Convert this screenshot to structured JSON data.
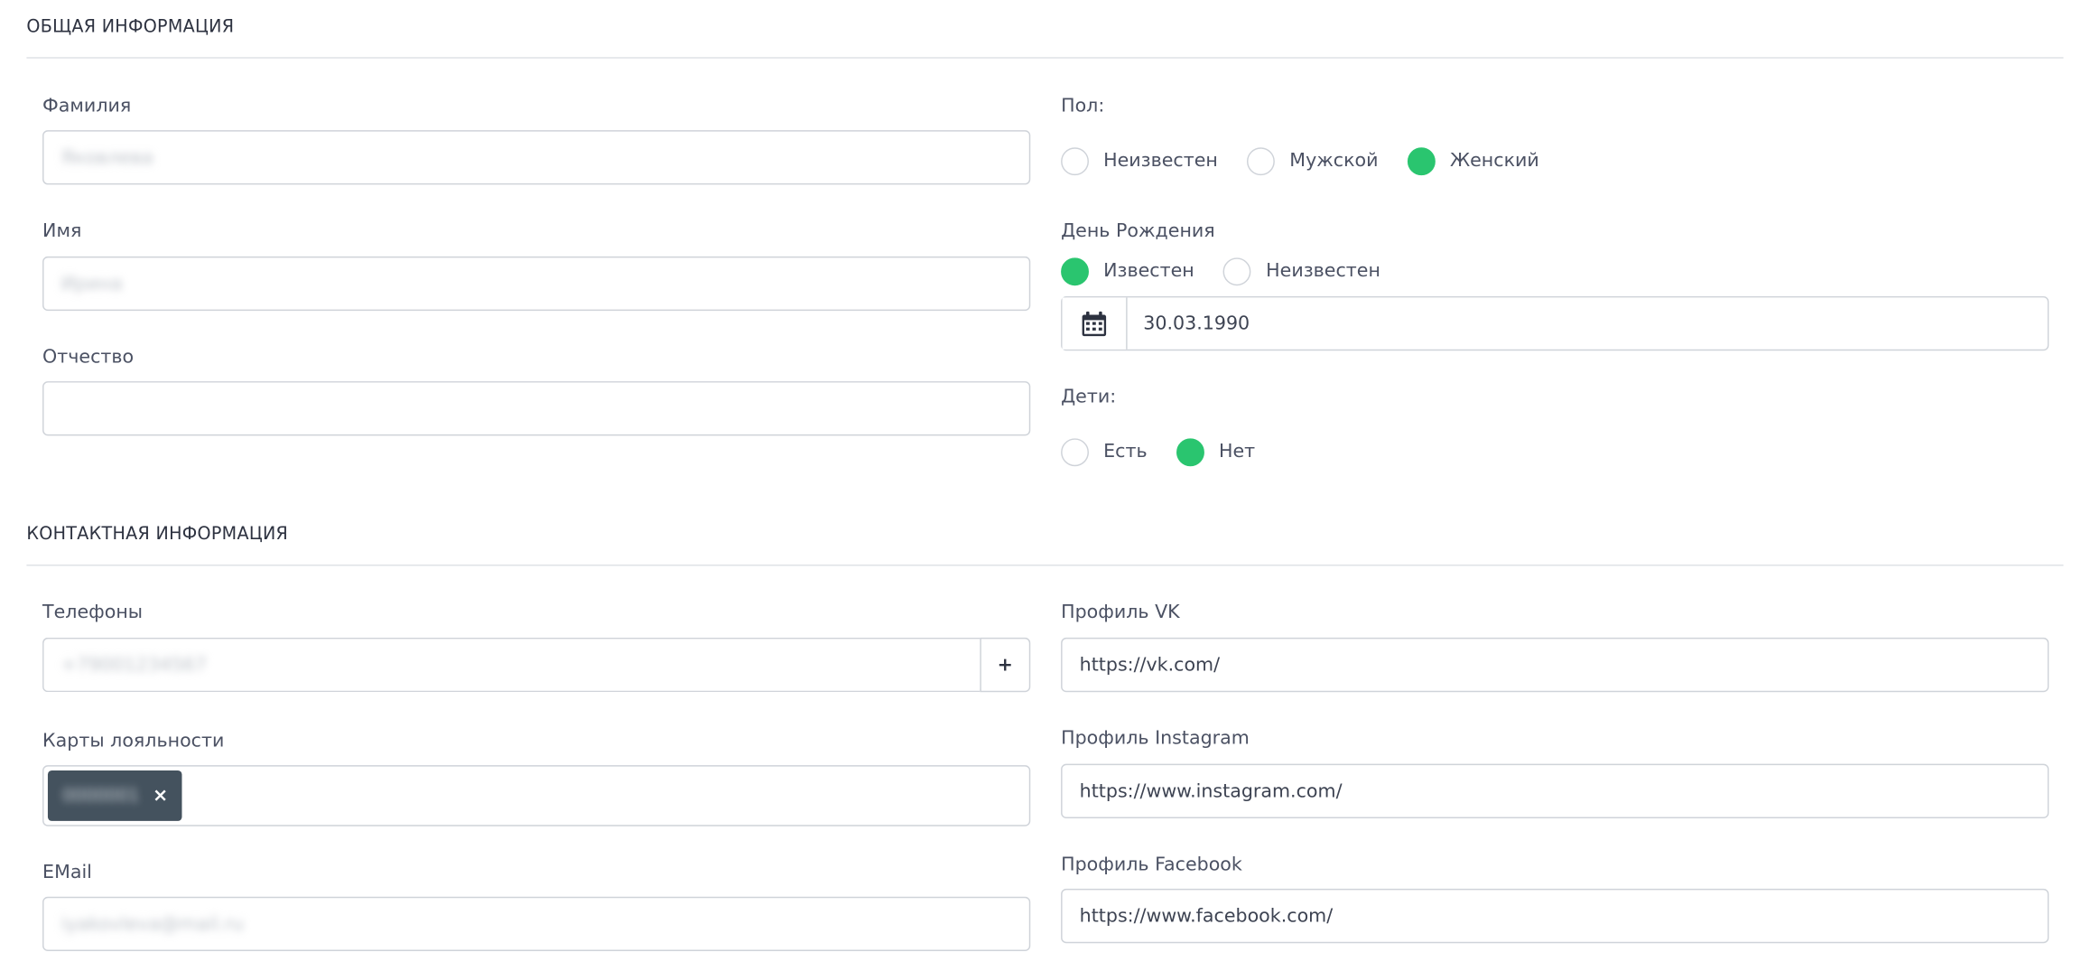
{
  "general": {
    "title": "ОБЩАЯ ИНФОРМАЦИЯ",
    "last_name": {
      "label": "Фамилия",
      "value": "Яковлева"
    },
    "first_name": {
      "label": "Имя",
      "value": "Ирина"
    },
    "patronymic": {
      "label": "Отчество",
      "value": ""
    },
    "gender": {
      "label": "Пол:",
      "options": [
        "Неизвестен",
        "Мужской",
        "Женский"
      ],
      "selected": "Женский"
    },
    "birthday": {
      "label": "День Рождения",
      "options": [
        "Известен",
        "Неизвестен"
      ],
      "selected": "Известен",
      "value": "30.03.1990",
      "icon": "calendar-icon"
    },
    "children": {
      "label": "Дети:",
      "options": [
        "Есть",
        "Нет"
      ],
      "selected": "Нет"
    }
  },
  "contact": {
    "title": "КОНТАКТНАЯ ИНФОРМАЦИЯ",
    "phones": {
      "label": "Телефоны",
      "value": "+79001234567",
      "add_label": "+"
    },
    "loyalty_cards": {
      "label": "Карты лояльности",
      "tag": "0000001",
      "tag_close": "×"
    },
    "email": {
      "label": "EMail",
      "value": "iyakovleva@mail.ru"
    },
    "vk": {
      "label": "Профиль VK",
      "value": "https://vk.com/"
    },
    "instagram": {
      "label": "Профиль Instagram",
      "value": "https://www.instagram.com/"
    },
    "facebook": {
      "label": "Профиль Facebook",
      "value": "https://www.facebook.com/"
    }
  },
  "colors": {
    "accent": "#2ac56f",
    "tag_bg": "#44525e",
    "border": "#cfd3d9"
  }
}
